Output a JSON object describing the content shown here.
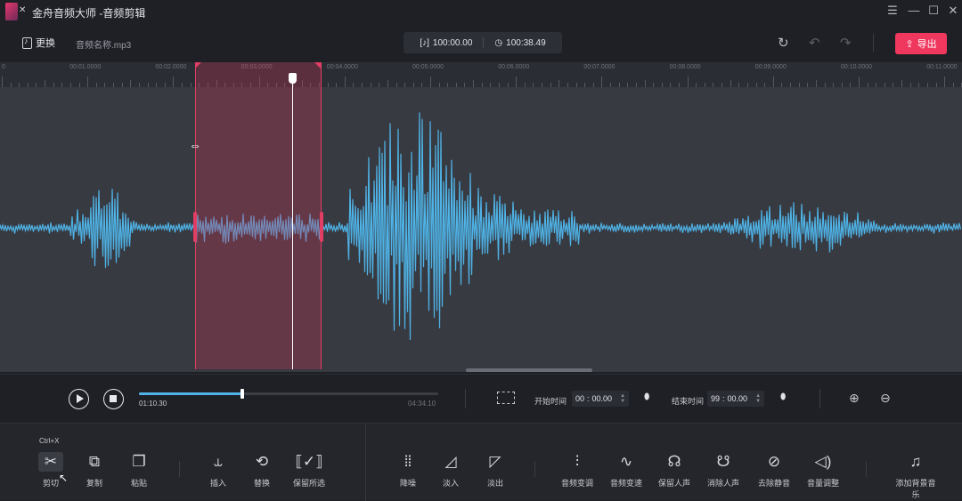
{
  "window": {
    "title": "金舟音频大师 -音频剪辑",
    "logo_mark": "✕"
  },
  "toolbar": {
    "replace_label": "更换",
    "file_name": "音频名称.mp3",
    "selection_length": "100:00.00",
    "total_length": "100:38.49",
    "export_label": "导出"
  },
  "ruler": {
    "labels": [
      "0",
      "00:01.0000",
      "00:02.0000",
      "00:03.0000",
      "00:04.0000",
      "00:05.0000",
      "00:06.0000",
      "00:07.0000",
      "00:08.0000",
      "00:09.0000",
      "00:10.0000",
      "00:11.0000"
    ]
  },
  "playback": {
    "current_time": "01:10.30",
    "total_time": "04:34.10",
    "progress": 0.345
  },
  "range": {
    "start_label": "开始时间",
    "start_min": "00",
    "start_sec": "00.00",
    "end_label": "结束时间",
    "end_min": "99",
    "end_sec": "00.00"
  },
  "tools_left": [
    {
      "name": "cut",
      "label": "剪切",
      "icon": "scissors-icon"
    },
    {
      "name": "copy",
      "label": "复制",
      "icon": "copy-icon"
    },
    {
      "name": "paste",
      "label": "粘贴",
      "icon": "paste-icon"
    },
    {
      "name": "insert",
      "label": "插入",
      "icon": "insert-icon"
    },
    {
      "name": "replace",
      "label": "替换",
      "icon": "replace-icon"
    },
    {
      "name": "keep-selected",
      "label": "保留所选",
      "icon": "keep-selected-icon"
    }
  ],
  "tools_right": [
    {
      "name": "denoise",
      "label": "降噪",
      "icon": "denoise-icon"
    },
    {
      "name": "fade-in",
      "label": "淡入",
      "icon": "fade-in-icon"
    },
    {
      "name": "fade-out",
      "label": "淡出",
      "icon": "fade-out-icon"
    },
    {
      "name": "pitch",
      "label": "音频变调",
      "icon": "pitch-icon"
    },
    {
      "name": "speed",
      "label": "音频变速",
      "icon": "speed-icon"
    },
    {
      "name": "keep-vocal",
      "label": "保留人声",
      "icon": "keep-vocal-icon"
    },
    {
      "name": "remove-vocal",
      "label": "消除人声",
      "icon": "remove-vocal-icon"
    },
    {
      "name": "remove-silence",
      "label": "去除静音",
      "icon": "remove-silence-icon"
    },
    {
      "name": "volume",
      "label": "音量调整",
      "icon": "volume-icon"
    },
    {
      "name": "add-bgm",
      "label": "添加背景音乐",
      "icon": "music-note-icon"
    }
  ],
  "tooltip": {
    "shortcut": "Ctrl+X"
  },
  "colors": {
    "accent": "#f0385f",
    "waveform": "#4fb3e6",
    "selection": "#e23e64"
  }
}
